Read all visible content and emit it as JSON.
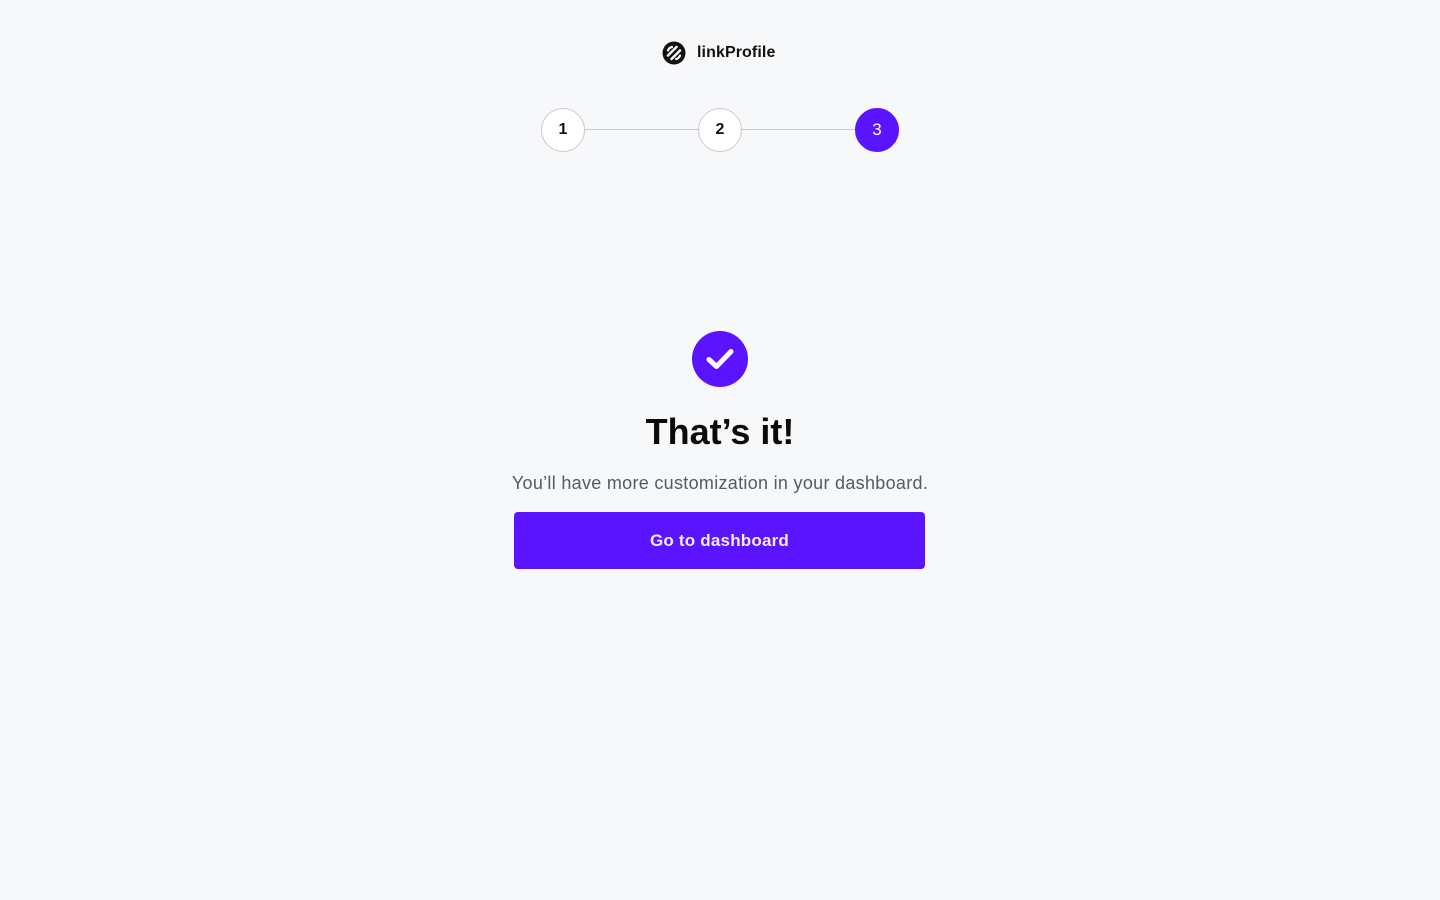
{
  "brand": {
    "name": "linkProfile",
    "icon": "link-logo-icon"
  },
  "stepper": {
    "steps": [
      {
        "label": "1",
        "state": "completed"
      },
      {
        "label": "2",
        "state": "completed"
      },
      {
        "label": "3",
        "state": "active"
      }
    ],
    "active_step": 3
  },
  "success": {
    "icon": "check-circle-icon",
    "title": "That’s it!",
    "subtitle": "You’ll have more customization in your dashboard.",
    "button_label": "Go to dashboard"
  },
  "colors": {
    "accent": "#5b14ff",
    "background": "#f7f8fa",
    "text": "#0b0b0b",
    "muted_text": "#555a63",
    "border": "#c9cbd1"
  }
}
